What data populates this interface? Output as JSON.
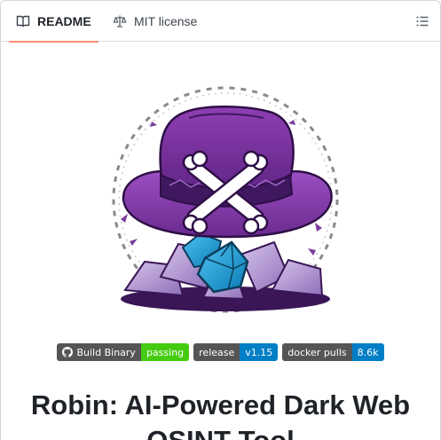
{
  "tabs": {
    "readme": {
      "label": "README",
      "icon": "book-icon"
    },
    "license": {
      "label": "MIT license",
      "icon": "scale-icon"
    },
    "outline": {
      "icon": "list-unordered-icon"
    }
  },
  "logo": {
    "icon": "hat-crossbones-dice-logo"
  },
  "badges": [
    {
      "left": "Build Binary",
      "right": "passing",
      "color": "#44cc11",
      "icon": "github-icon"
    },
    {
      "left": "release",
      "right": "v1.15",
      "color": "#007ec6"
    },
    {
      "left": "docker pulls",
      "right": "8.6k",
      "color": "#007ec6"
    }
  ],
  "heading": "Robin: AI-Powered Dark Web OSINT Tool"
}
